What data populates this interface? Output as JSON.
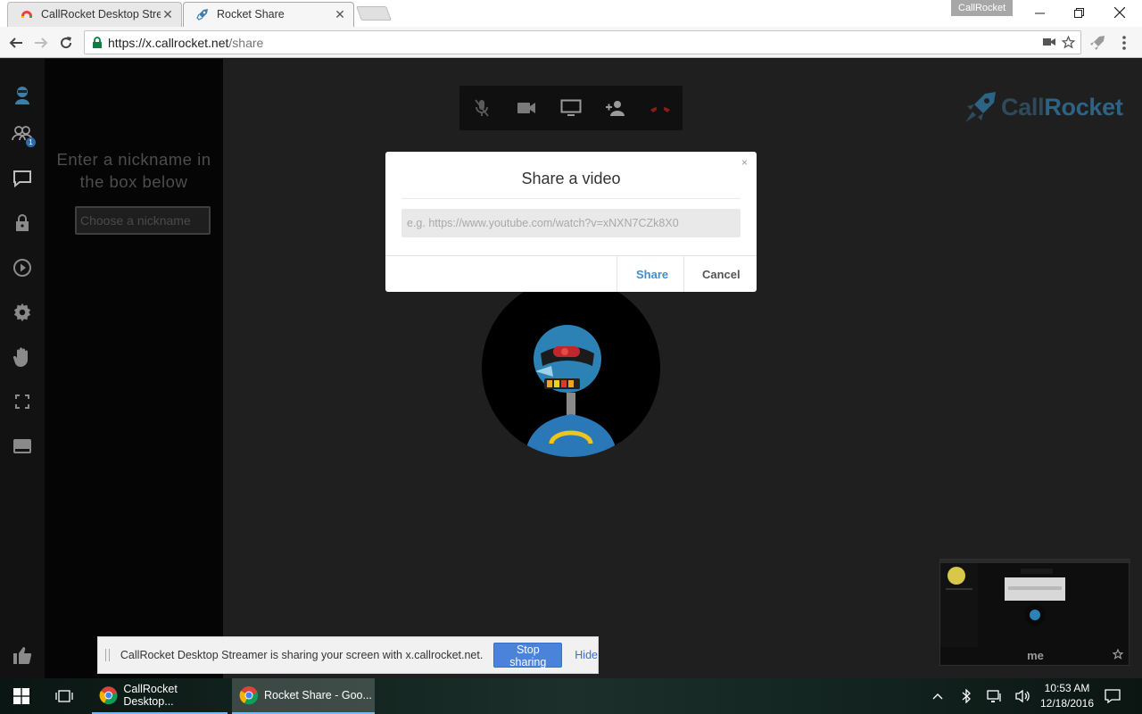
{
  "browser": {
    "tabs": [
      {
        "title": "CallRocket Desktop Strea",
        "active": false
      },
      {
        "title": "Rocket Share",
        "active": true
      }
    ],
    "profile_name": "CallRocket",
    "url_host": "https://x.callrocket.net",
    "url_path": "/share"
  },
  "sidebar": {
    "chat_prompt": "Enter a nickname in the box below",
    "nickname_placeholder": "Choose a nickname",
    "participant_count": "1"
  },
  "logo": {
    "part1": "Call",
    "part2": "Rocket"
  },
  "modal": {
    "close": "×",
    "title": "Share a video",
    "url_placeholder": "e.g. https://www.youtube.com/watch?v=xNXN7CZk8X0",
    "share_label": "Share",
    "cancel_label": "Cancel"
  },
  "preview": {
    "label": "me"
  },
  "sharebar": {
    "message": "CallRocket Desktop Streamer is sharing your screen with x.callrocket.net.",
    "stop_label": "Stop sharing",
    "hide_label": "Hide"
  },
  "taskbar": {
    "apps": [
      {
        "label": "CallRocket Desktop..."
      },
      {
        "label": "Rocket Share - Goo..."
      }
    ],
    "time": "10:53 AM",
    "date": "12/18/2016"
  },
  "colors": {
    "accent_blue": "#3d8fd1",
    "stop_button": "#4b82dc",
    "logo_dark": "#2f4a5a",
    "logo_blue": "#2d6384",
    "hangup_red": "#8a1c1c"
  }
}
